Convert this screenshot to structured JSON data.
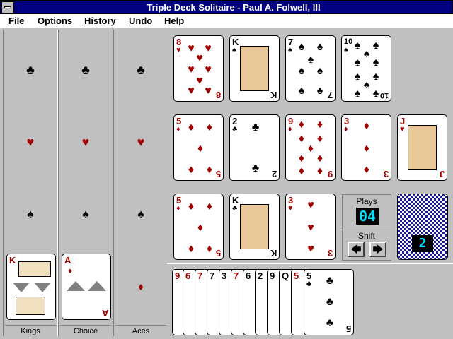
{
  "window": {
    "title": "Triple Deck Solitaire - Paul A. Folwell, III"
  },
  "menu": [
    {
      "label": "File",
      "accel": "F"
    },
    {
      "label": "Options",
      "accel": "O"
    },
    {
      "label": "History",
      "accel": "H"
    },
    {
      "label": "Undo",
      "accel": "U"
    },
    {
      "label": "Help",
      "accel": "H"
    }
  ],
  "columns": {
    "kings": {
      "label": "Kings",
      "suits": [
        "♣",
        "♥",
        "♠"
      ],
      "card_rank": "K"
    },
    "choice": {
      "label": "Choice",
      "suits": [
        "♣",
        "♥",
        "♠"
      ],
      "card_rank": "A"
    },
    "aces": {
      "label": "Aces",
      "suits": [
        "♣",
        "♥",
        "♠",
        "♦"
      ]
    }
  },
  "tableau": {
    "row1": [
      {
        "rank": "8",
        "suit": "♥",
        "color": "red"
      },
      {
        "rank": "K",
        "suit": "♠",
        "color": "blk"
      },
      {
        "rank": "7",
        "suit": "♠",
        "color": "blk"
      },
      {
        "rank": "10",
        "suit": "♠",
        "color": "blk"
      }
    ],
    "row2": [
      {
        "rank": "5",
        "suit": "♦",
        "color": "red"
      },
      {
        "rank": "2",
        "suit": "♣",
        "color": "blk"
      },
      {
        "rank": "9",
        "suit": "♦",
        "color": "red"
      },
      {
        "rank": "3",
        "suit": "♦",
        "color": "red"
      },
      {
        "rank": "J",
        "suit": "♥",
        "color": "red"
      }
    ],
    "row3": [
      {
        "rank": "5",
        "suit": "♦",
        "color": "red"
      },
      {
        "rank": "K",
        "suit": "♣",
        "color": "blk"
      },
      {
        "rank": "3",
        "suit": "♥",
        "color": "red"
      }
    ]
  },
  "plays": {
    "label": "Plays",
    "value": "04"
  },
  "shift": {
    "label": "Shift",
    "left_icon": "arrow-left-icon",
    "right_icon": "arrow-right-icon"
  },
  "deck": {
    "remaining": "2"
  },
  "hand": [
    {
      "rank": "9",
      "color": "red"
    },
    {
      "rank": "6",
      "color": "red"
    },
    {
      "rank": "7",
      "color": "red"
    },
    {
      "rank": "7",
      "color": "blk"
    },
    {
      "rank": "3",
      "color": "blk"
    },
    {
      "rank": "7",
      "color": "red"
    },
    {
      "rank": "6",
      "color": "blk"
    },
    {
      "rank": "2",
      "color": "blk"
    },
    {
      "rank": "9",
      "color": "blk"
    },
    {
      "rank": "Q",
      "color": "blk"
    },
    {
      "rank": "5",
      "color": "red"
    },
    {
      "rank": "5",
      "color": "blk",
      "suit": "♣"
    }
  ],
  "colors": {
    "title_bg": "#000080",
    "red_suit": "#a00000",
    "table": "#c0c0c0",
    "lcd": "#00e0ff"
  }
}
